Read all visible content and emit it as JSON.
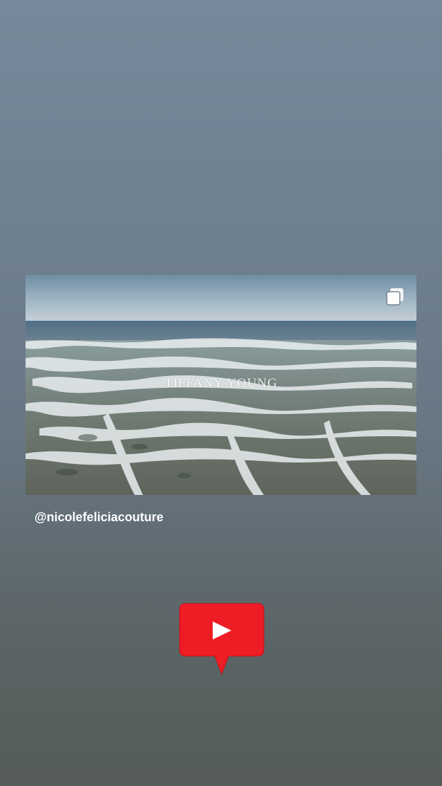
{
  "post": {
    "overlay_title": "TIFFANY YOUNG",
    "multi_icon": "multiple-images-icon",
    "image_subject": "ocean-waves-beach"
  },
  "mention": {
    "handle": "@nicolefeliciacouture"
  },
  "sticker": {
    "icon": "youtube-play-icon",
    "bubble_color": "#ee1c25",
    "play_color": "#ffffff"
  },
  "colors": {
    "background_top": "#76899a",
    "background_bottom": "#555c58"
  }
}
